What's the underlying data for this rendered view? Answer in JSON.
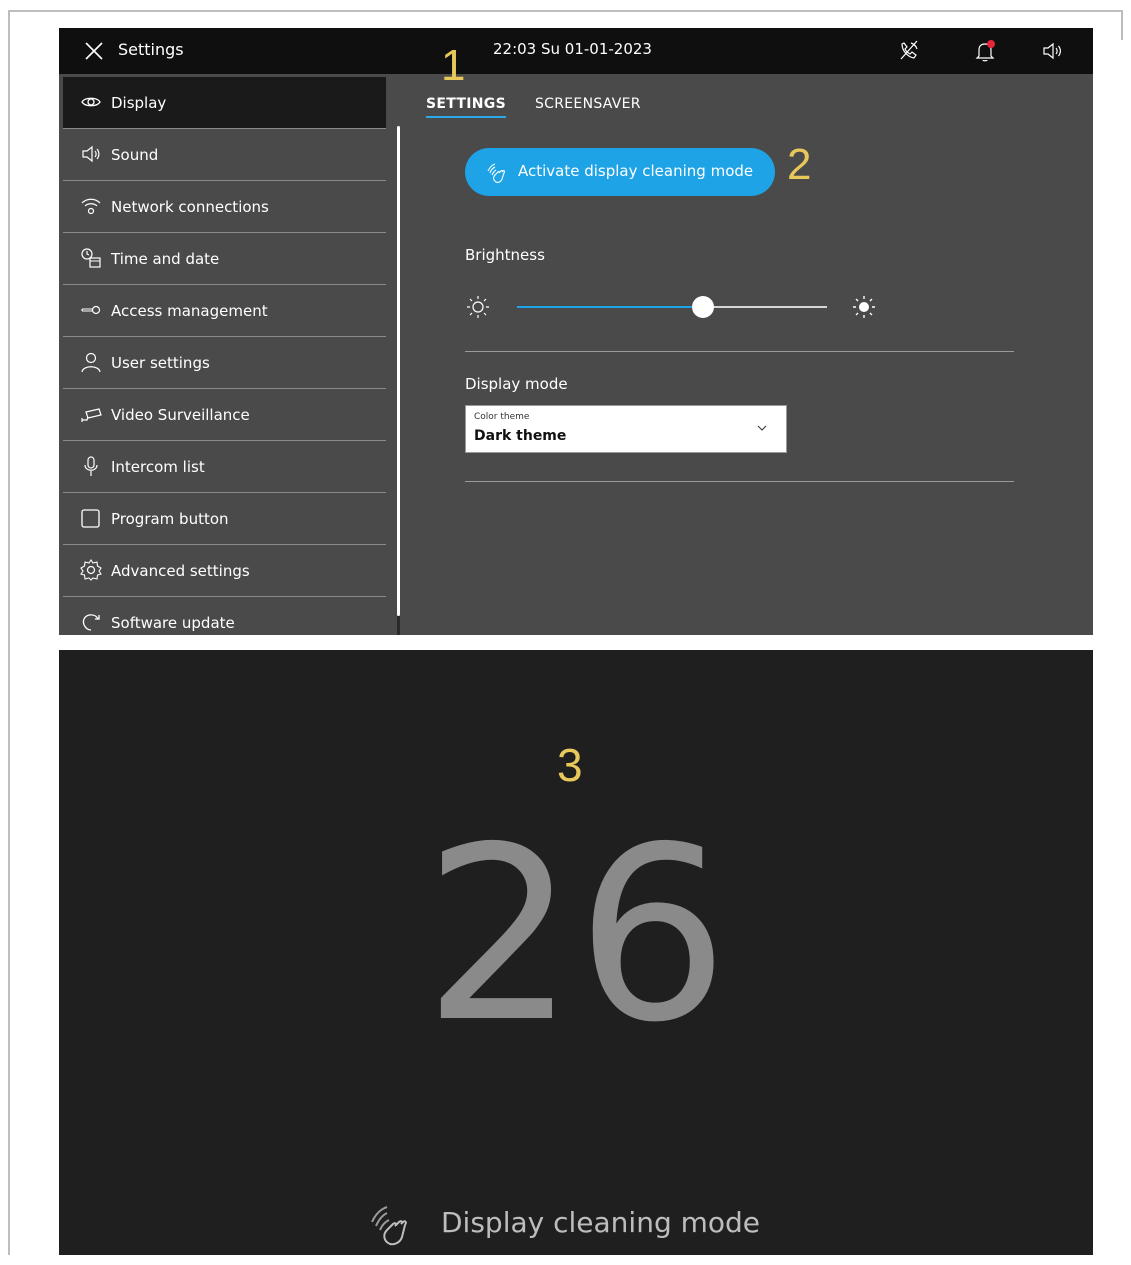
{
  "topbar": {
    "title": "Settings",
    "datetime": "22:03 Su 01-01-2023"
  },
  "sidebar": {
    "items": [
      {
        "label": "Display",
        "icon": "eye-icon"
      },
      {
        "label": "Sound",
        "icon": "speaker-icon"
      },
      {
        "label": "Network connections",
        "icon": "wifi-icon"
      },
      {
        "label": "Time and date",
        "icon": "clock-calendar-icon"
      },
      {
        "label": "Access  management",
        "icon": "key-icon"
      },
      {
        "label": "User settings",
        "icon": "user-icon"
      },
      {
        "label": "Video Surveillance",
        "icon": "camera-icon"
      },
      {
        "label": "Intercom list",
        "icon": "microphone-icon"
      },
      {
        "label": "Program button",
        "icon": "square-icon"
      },
      {
        "label": "Advanced settings",
        "icon": "gear-icon"
      },
      {
        "label": "Software update",
        "icon": "refresh-icon"
      }
    ]
  },
  "tabs": {
    "settings": "SETTINGS",
    "screensaver": "SCREENSAVER"
  },
  "display": {
    "cleaning_button": "Activate display cleaning mode",
    "brightness_label": "Brightness",
    "brightness_level": 0.6,
    "display_mode_label": "Display mode",
    "color_theme_caption": "Color theme",
    "color_theme_value": "Dark theme"
  },
  "callouts": {
    "one": "1",
    "two": "2",
    "three": "3"
  },
  "cleaning_screen": {
    "countdown": "26",
    "label": "Display cleaning mode"
  },
  "colors": {
    "accent": "#1ea3e6",
    "callout": "#e8c85a",
    "notification_dot": "#e8243a"
  }
}
